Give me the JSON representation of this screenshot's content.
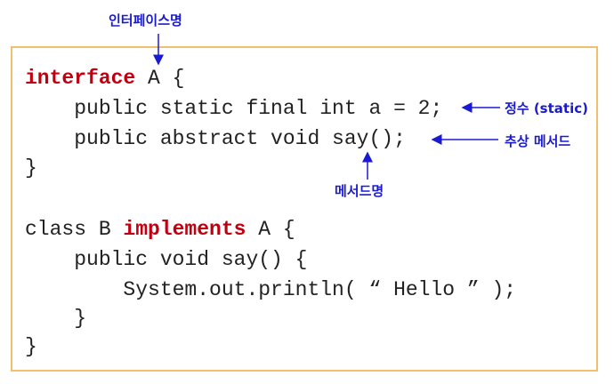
{
  "annotations": {
    "interface_name": "인터페이스명",
    "constant": "정수 (static)",
    "abstract_method": "추상 메서드",
    "method_name": "메서드명"
  },
  "code": {
    "l1_kw": "interface",
    "l1_rest": " A {",
    "l2": "    public static final int a = 2;",
    "l3": "    public abstract void say();",
    "l4": "}",
    "l5_a": "class B ",
    "l5_kw": "implements",
    "l5_b": " A {",
    "l6": "    public void say() {",
    "l7": "        System.out.println( “ Hello ” );",
    "l8": "    }",
    "l9": "}"
  },
  "colors": {
    "keyword": "#c00010",
    "annotation": "#1a1ad0",
    "border": "#f0c070"
  }
}
